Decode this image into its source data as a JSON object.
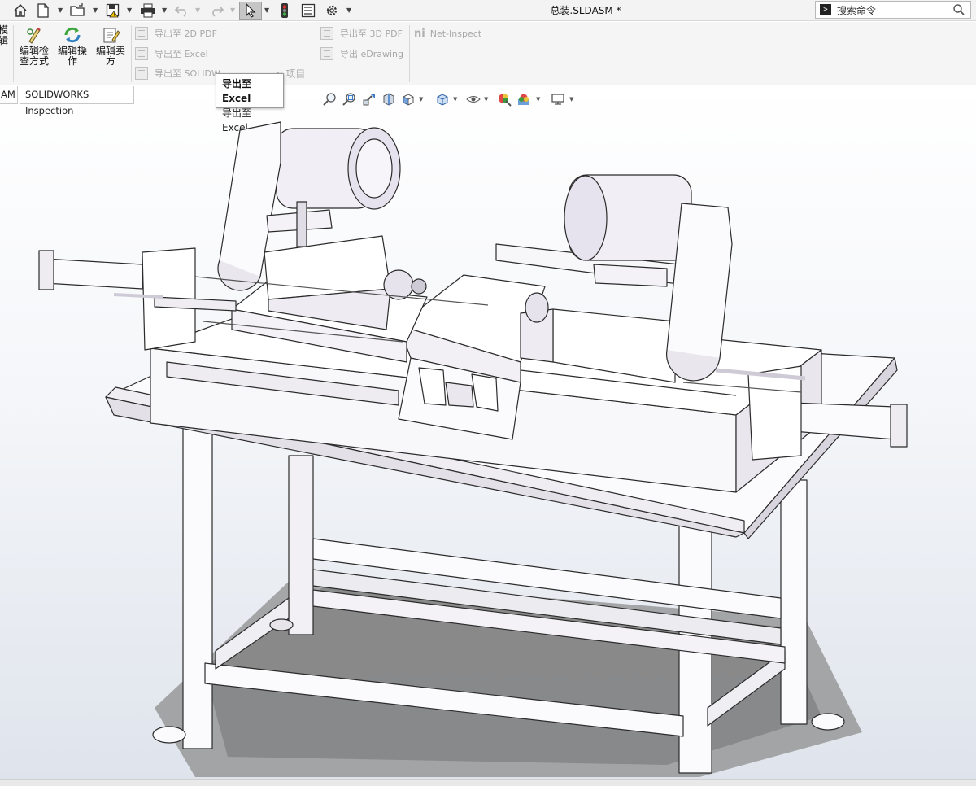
{
  "title_bar": {
    "document_title": "总装.SLDASM *",
    "search_placeholder": "搜索命令",
    "quick_access": [
      {
        "name": "home-icon"
      },
      {
        "name": "new-document-icon"
      },
      {
        "name": "open-folder-icon"
      },
      {
        "name": "save-icon"
      },
      {
        "name": "print-icon"
      },
      {
        "name": "undo-icon"
      },
      {
        "name": "redo-icon"
      },
      {
        "name": "select-cursor-icon"
      },
      {
        "name": "rebuild-traffic-light-icon"
      },
      {
        "name": "file-properties-icon"
      },
      {
        "name": "options-gear-icon"
      }
    ]
  },
  "ribbon": {
    "partial_left_label": "模\n辑",
    "big_buttons": [
      {
        "label": "编辑检\n查方式",
        "icon": "edit-inspection-method-icon"
      },
      {
        "label": "编辑操\n作",
        "icon": "edit-operation-icon"
      },
      {
        "label": "编辑卖\n方",
        "icon": "edit-vendor-icon"
      }
    ],
    "export_buttons": [
      {
        "label": "导出至 2D PDF",
        "icon": "export-2d-pdf-icon"
      },
      {
        "label": "导出至 Excel",
        "icon": "export-excel-icon"
      },
      {
        "label": "导出至 SOLIDW",
        "icon": "export-solidworks-icon"
      },
      {
        "label": "导出至 3D PDF",
        "icon": "export-3d-pdf-icon"
      },
      {
        "label": "导出 eDrawing",
        "icon": "export-edrawing-icon"
      }
    ],
    "hidden_partial_label": "n 项目",
    "net_inspect_label": "Net-Inspect"
  },
  "tabs": [
    {
      "label": "AM"
    },
    {
      "label": "SOLIDWORKS Inspection"
    }
  ],
  "tooltip": {
    "title": "导出至 Excel",
    "description": "导出至 Excel"
  },
  "heads_up_toolbar": [
    {
      "name": "zoom-to-fit-icon"
    },
    {
      "name": "zoom-to-area-icon"
    },
    {
      "name": "previous-view-icon"
    },
    {
      "name": "section-view-icon"
    },
    {
      "name": "view-orientation-icon"
    },
    {
      "name": "display-style-icon"
    },
    {
      "name": "hide-show-items-icon"
    },
    {
      "name": "edit-appearance-icon"
    },
    {
      "name": "apply-scene-icon"
    },
    {
      "name": "view-settings-icon"
    }
  ],
  "colors": {
    "accent_blue": "#1f5fa8",
    "model_face": "#fbfbfd",
    "model_shade": "#e6e2ec",
    "motor": "#f0eef4",
    "floor_shadow": "#8a8a8a"
  }
}
